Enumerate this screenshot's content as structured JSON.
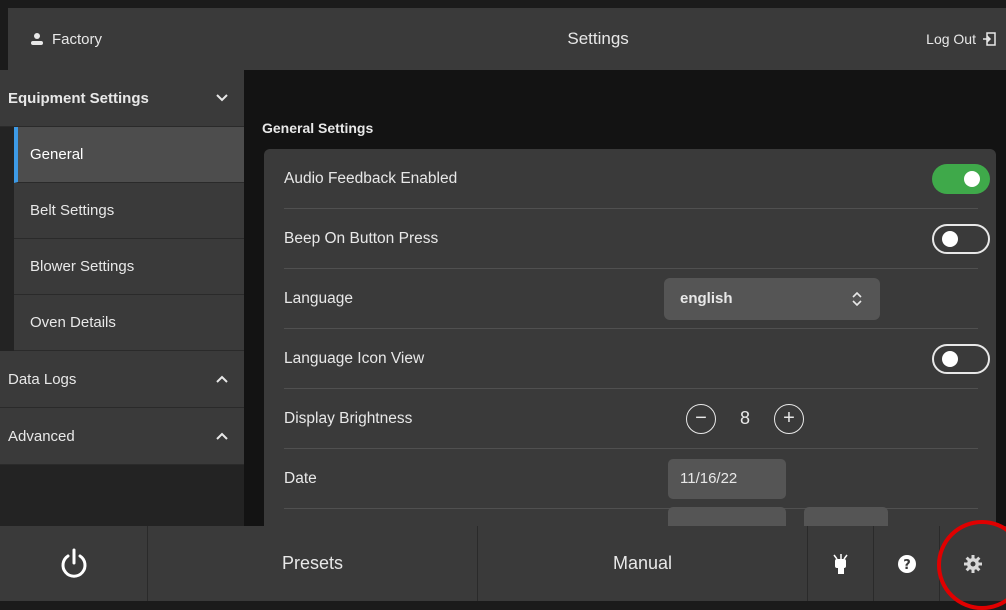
{
  "header": {
    "user_name": "Factory",
    "title": "Settings",
    "logout_label": "Log Out"
  },
  "sidebar": {
    "equipment_settings": "Equipment Settings",
    "items": [
      {
        "label": "General",
        "active": true
      },
      {
        "label": "Belt Settings"
      },
      {
        "label": "Blower Settings"
      },
      {
        "label": "Oven Details"
      }
    ],
    "data_logs": "Data Logs",
    "advanced": "Advanced"
  },
  "main": {
    "section_title": "General Settings",
    "rows": {
      "audio_feedback": {
        "label": "Audio Feedback Enabled",
        "state": "on"
      },
      "beep": {
        "label": "Beep On Button Press",
        "state": "off"
      },
      "language": {
        "label": "Language",
        "value": "english"
      },
      "language_icon_view": {
        "label": "Language Icon View",
        "state": "off"
      },
      "brightness": {
        "label": "Display Brightness",
        "value": "8"
      },
      "date": {
        "label": "Date",
        "value": "11/16/22"
      }
    }
  },
  "bottom": {
    "presets": "Presets",
    "manual": "Manual"
  },
  "icons": {
    "user": "user-icon",
    "logout": "logout-icon",
    "power": "power-icon",
    "help": "help-icon",
    "settings": "gear-icon"
  },
  "colors": {
    "accent_blue": "#3d9ae6",
    "toggle_on": "#3fa94a",
    "highlight_ring": "#e00000"
  }
}
